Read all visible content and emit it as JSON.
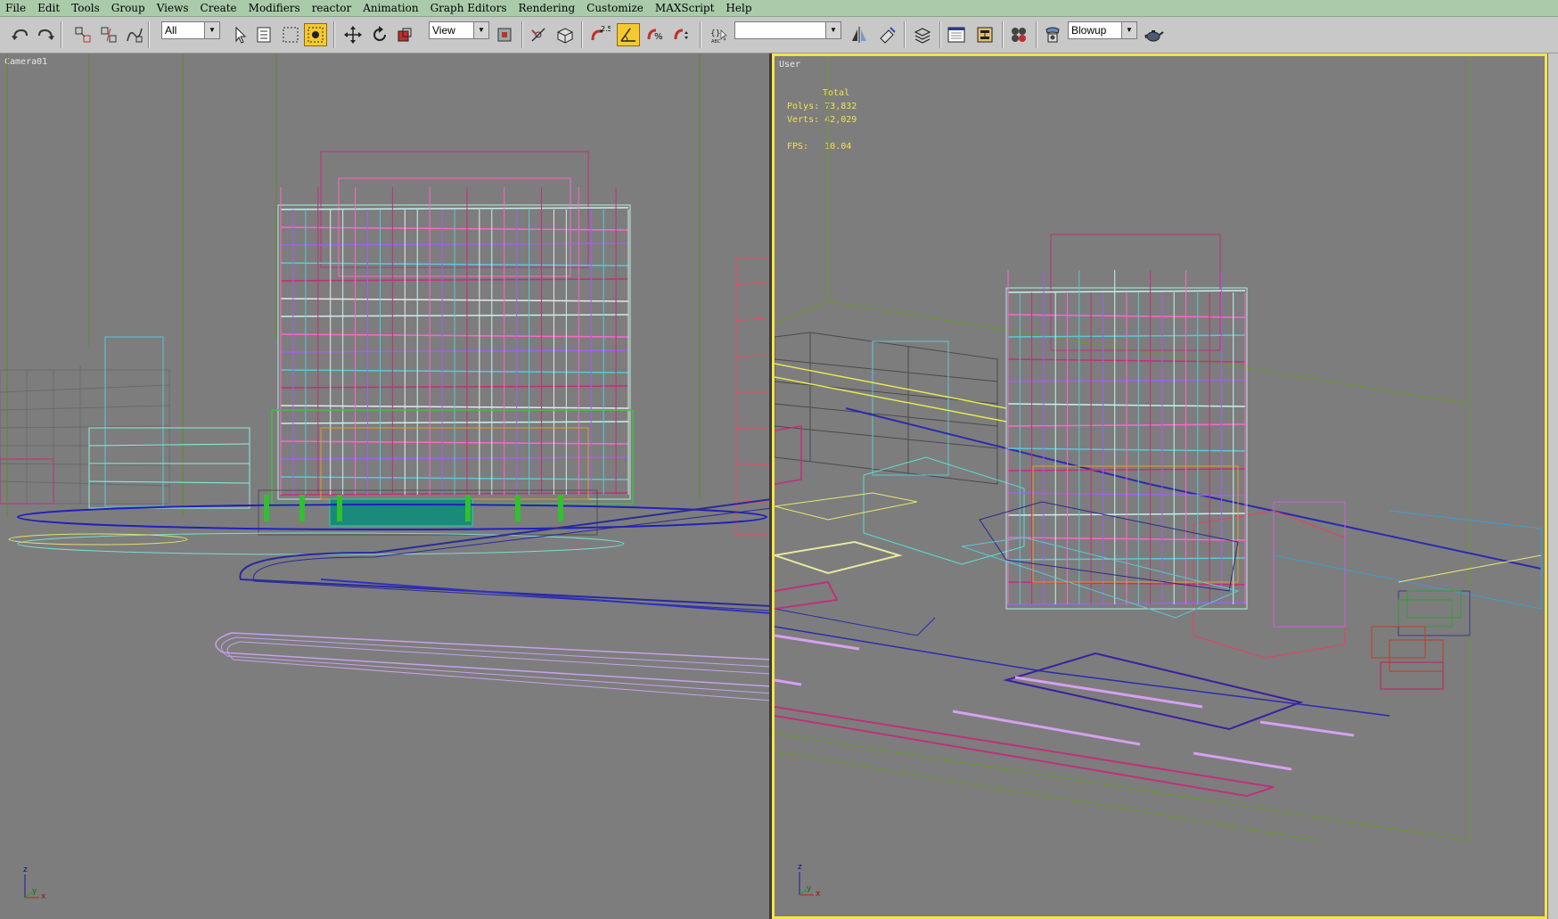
{
  "menu": [
    "File",
    "Edit",
    "Tools",
    "Group",
    "Views",
    "Create",
    "Modifiers",
    "reactor",
    "Animation",
    "Graph Editors",
    "Rendering",
    "Customize",
    "MAXScript",
    "Help"
  ],
  "toolbar": {
    "selection_filter": "All",
    "reference_coord": "View",
    "snap_angle_label": "2.5",
    "named_selection_set": "",
    "render_type": "Blowup"
  },
  "viewports": {
    "left": {
      "label": "Camera01"
    },
    "right": {
      "label": "User",
      "stats_header": "Total",
      "polys_label": "Polys:",
      "polys_value": "73,832",
      "verts_label": "Verts:",
      "verts_value": "42,029",
      "fps_label": "FPS:",
      "fps_value": "10.04"
    }
  },
  "axis_labels": {
    "z": "z",
    "y": "y",
    "x": "x"
  },
  "colors": {
    "active_border": "#f5e24a",
    "viewport_bg": "#7d7d7d",
    "menubar_bg": "#a9cba9"
  }
}
